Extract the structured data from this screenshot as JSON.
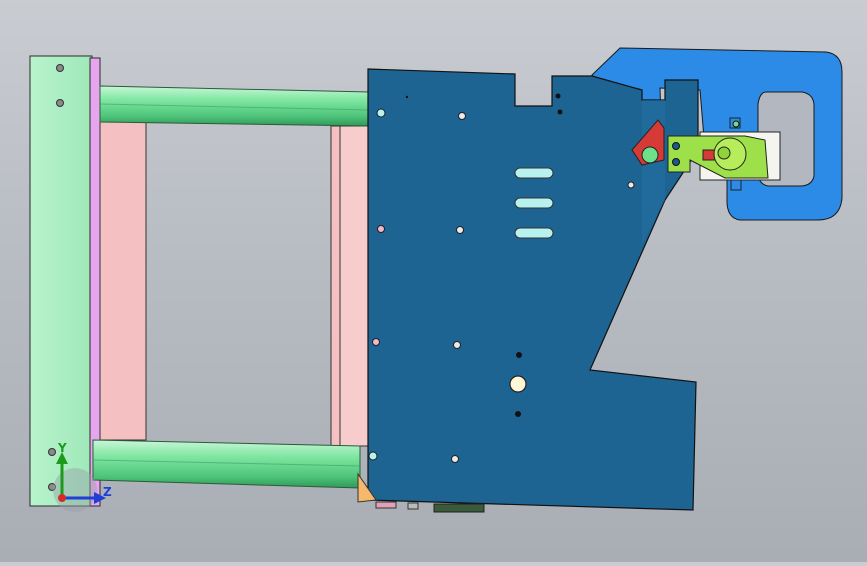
{
  "window": {
    "type": "cad-3d-viewport"
  },
  "triad": {
    "y_label": "Y",
    "z_label": "Z"
  },
  "colors": {
    "background_top": "#c9ccd1",
    "background_bottom": "#a9adb4",
    "main_plate": "#1d6493",
    "bracket": "#2b8be6",
    "side_post": "#a8eec2",
    "rods": "#6ee095",
    "pink_plates": "#f4c0c2",
    "clamp_green": "#9ee04a",
    "red_part": "#d63a36",
    "slots": "#b8f2ef"
  }
}
